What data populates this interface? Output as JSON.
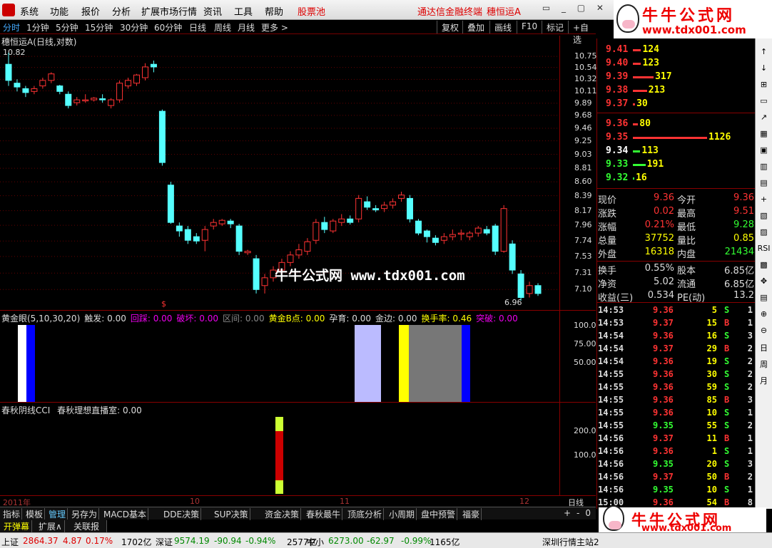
{
  "menu": [
    "系统",
    "功能",
    "报价",
    "分析",
    "扩展市场行情",
    "资讯",
    "工具",
    "帮助"
  ],
  "menu_red": "股票池",
  "app_title": "通达信金融终端",
  "stock_title": "穗恒运A",
  "banner": {
    "title": "牛牛公式网",
    "url": "www.tdx001.com"
  },
  "periods": [
    "分时",
    "1分钟",
    "5分钟",
    "15分钟",
    "30分钟",
    "60分钟",
    "日线",
    "周线",
    "月线",
    "更多 >"
  ],
  "tool_buttons": [
    "复权",
    "叠加",
    "画线",
    "F10",
    "标记",
    "+自选"
  ],
  "chart_title": "穗恒运A(日线,对数)",
  "high_label": "10.82",
  "low_label": "6.96",
  "watermark": "牛牛公式网 www.tdx001.com",
  "price_ticks": [
    "10.75",
    "10.54",
    "10.32",
    "10.11",
    "9.89",
    "9.68",
    "9.46",
    "9.25",
    "9.03",
    "8.81",
    "8.60",
    "8.39",
    "8.17",
    "7.96",
    "7.74",
    "7.53",
    "7.31",
    "7.10"
  ],
  "ind1": {
    "name": "黄金眼(5,10,30,20)",
    "items": [
      {
        "l": "触发: 0.00",
        "c": "#ddd"
      },
      {
        "l": "回踩: 0.00",
        "c": "#e0e"
      },
      {
        "l": "破坏: 0.00",
        "c": "#e0e"
      },
      {
        "l": "区间: 0.00",
        "c": "#888"
      },
      {
        "l": "黄金B点: 0.00",
        "c": "#ff0"
      },
      {
        "l": "孕育: 0.00",
        "c": "#ddd"
      },
      {
        "l": "金边: 0.00",
        "c": "#ddd"
      },
      {
        "l": "换手率: 0.46",
        "c": "#ff0"
      },
      {
        "l": "突破: 0.00",
        "c": "#e0e"
      }
    ],
    "ticks": [
      "100.0",
      "75.00",
      "50.00"
    ]
  },
  "ind2": {
    "name": "春秋阴线CCI",
    "sub": "春秋理想直播室: 0.00",
    "ticks": [
      "200.0",
      "100.0"
    ]
  },
  "dates": [
    "2011年",
    "10",
    "11",
    "12"
  ],
  "date_period": "日线",
  "tabs": [
    "指标",
    "模板",
    "管理",
    "另存为",
    "MACD基本",
    "DDE决策",
    "SUP决策",
    "资金决策",
    "春秋最牛",
    "顶底分析",
    "小周期",
    "盘中预警",
    "福豪"
  ],
  "tabs2": [
    "开弹幕",
    "扩展∧",
    "关联报价"
  ],
  "order_book": {
    "asks": [
      {
        "p": "9.41",
        "v": "124",
        "w": 0.11
      },
      {
        "p": "9.40",
        "v": "123",
        "w": 0.11
      },
      {
        "p": "9.39",
        "v": "317",
        "w": 0.28
      },
      {
        "p": "9.38",
        "v": "213",
        "w": 0.19
      },
      {
        "p": "9.37",
        "v": "30",
        "w": 0.03
      }
    ],
    "bids": [
      {
        "p": "9.36",
        "v": "80",
        "w": 0.07
      },
      {
        "p": "9.35",
        "v": "1126",
        "w": 1.0
      },
      {
        "p": "9.34",
        "v": "113",
        "w": 0.1
      },
      {
        "p": "9.33",
        "v": "191",
        "w": 0.17
      },
      {
        "p": "9.32",
        "v": "16",
        "w": 0.02
      }
    ]
  },
  "quote": [
    [
      "现价",
      "9.36",
      "今开",
      "9.36"
    ],
    [
      "涨跌",
      "0.02",
      "最高",
      "9.51"
    ],
    [
      "涨幅",
      "0.21%",
      "最低",
      "9.28"
    ],
    [
      "总量",
      "37752",
      "量比",
      "0.85"
    ],
    [
      "外盘",
      "16318",
      "内盘",
      "21434"
    ],
    [
      "换手",
      "0.55%",
      "股本",
      "6.85亿"
    ],
    [
      "净资",
      "5.02",
      "流通",
      "6.85亿"
    ],
    [
      "收益(三)",
      "0.534",
      "PE(动)",
      "13.2"
    ]
  ],
  "trades": [
    [
      "14:53",
      "9.36",
      "5",
      "S",
      "1"
    ],
    [
      "14:53",
      "9.37",
      "15",
      "B",
      "1"
    ],
    [
      "14:54",
      "9.36",
      "16",
      "S",
      "3"
    ],
    [
      "14:54",
      "9.37",
      "29",
      "B",
      "2"
    ],
    [
      "14:54",
      "9.36",
      "19",
      "S",
      "2"
    ],
    [
      "14:55",
      "9.36",
      "30",
      "S",
      "2"
    ],
    [
      "14:55",
      "9.36",
      "59",
      "S",
      "2"
    ],
    [
      "14:55",
      "9.36",
      "85",
      "B",
      "3"
    ],
    [
      "14:55",
      "9.36",
      "10",
      "S",
      "1"
    ],
    [
      "14:55",
      "9.35",
      "55",
      "S",
      "2"
    ],
    [
      "14:56",
      "9.37",
      "11",
      "B",
      "1"
    ],
    [
      "14:56",
      "9.36",
      "1",
      "S",
      "1"
    ],
    [
      "14:56",
      "9.35",
      "20",
      "S",
      "3"
    ],
    [
      "14:56",
      "9.37",
      "50",
      "B",
      "2"
    ],
    [
      "14:56",
      "9.35",
      "10",
      "S",
      "1"
    ],
    [
      "15:00",
      "9.36",
      "54",
      "B",
      "8"
    ]
  ],
  "status": [
    {
      "t": "上证",
      "c": "#000"
    },
    {
      "t": "2864.37",
      "c": "#d00"
    },
    {
      "t": "4.87",
      "c": "#d00"
    },
    {
      "t": "0.17%",
      "c": "#d00"
    },
    {
      "t": "1702亿",
      "c": "#000"
    },
    {
      "t": "深证",
      "c": "#000"
    },
    {
      "t": "9574.19",
      "c": "#080"
    },
    {
      "t": "-90.94",
      "c": "#080"
    },
    {
      "t": "-0.94%",
      "c": "#080"
    },
    {
      "t": "2577亿",
      "c": "#000"
    },
    {
      "t": "中小",
      "c": "#000"
    },
    {
      "t": "6273.00",
      "c": "#080"
    },
    {
      "t": "-62.97",
      "c": "#080"
    },
    {
      "t": "-0.99%",
      "c": "#080"
    },
    {
      "t": "1165亿",
      "c": "#000"
    },
    {
      "t": "深圳行情主站2",
      "c": "#000"
    }
  ],
  "vtools": [
    "↑",
    "↓",
    "⊞",
    "▭",
    "↗",
    "▦",
    "▣",
    "▥",
    "▤",
    "+",
    "▧",
    "▨",
    "RSI",
    "▩",
    "✥",
    "▤",
    "⊕",
    "⊖",
    "日",
    "周",
    "月"
  ],
  "candles": [
    [
      10.6,
      10.3,
      10.82,
      10.2
    ],
    [
      10.25,
      10.18,
      10.32,
      10.1
    ],
    [
      10.15,
      10.08,
      10.2,
      10.0
    ],
    [
      10.1,
      10.15,
      10.2,
      10.05
    ],
    [
      10.2,
      10.3,
      10.35,
      10.15
    ],
    [
      10.3,
      10.42,
      10.45,
      10.25
    ],
    [
      10.2,
      10.1,
      10.22,
      10.05
    ],
    [
      10.05,
      9.85,
      10.1,
      9.8
    ],
    [
      9.9,
      9.95,
      10.0,
      9.85
    ],
    [
      9.95,
      9.95,
      10.05,
      9.9
    ],
    [
      9.95,
      9.98,
      10.0,
      9.92
    ],
    [
      9.97,
      9.95,
      10.05,
      9.9
    ],
    [
      9.85,
      9.95,
      9.98,
      9.8
    ],
    [
      9.95,
      10.25,
      10.3,
      9.9
    ],
    [
      10.2,
      10.3,
      10.35,
      10.15
    ],
    [
      10.25,
      10.4,
      10.42,
      10.2
    ],
    [
      10.35,
      10.55,
      10.62,
      10.3
    ],
    [
      10.6,
      10.55,
      10.67,
      10.45
    ],
    [
      9.75,
      8.9,
      9.78,
      8.85
    ],
    [
      8.55,
      8.0,
      8.6,
      7.98
    ],
    [
      7.95,
      7.88,
      8.0,
      7.8
    ],
    [
      7.9,
      7.75,
      7.95,
      7.7
    ],
    [
      7.8,
      7.74,
      7.85,
      7.7
    ],
    [
      7.75,
      7.9,
      7.95,
      7.6
    ],
    [
      7.95,
      8.0,
      8.05,
      7.9
    ],
    [
      7.98,
      8.03,
      8.05,
      7.95
    ],
    [
      8.02,
      7.98,
      8.05,
      7.92
    ],
    [
      7.95,
      7.6,
      7.98,
      7.55
    ],
    [
      7.58,
      7.6,
      7.62,
      7.55
    ],
    [
      7.5,
      7.1,
      7.55,
      7.05
    ],
    [
      7.15,
      7.25,
      7.3,
      7.05
    ],
    [
      7.25,
      7.35,
      7.4,
      7.2
    ],
    [
      7.35,
      7.45,
      7.5,
      7.3
    ],
    [
      7.45,
      7.55,
      7.6,
      7.4
    ],
    [
      7.55,
      7.62,
      7.7,
      7.5
    ],
    [
      7.6,
      7.73,
      7.78,
      7.55
    ],
    [
      7.75,
      8.0,
      8.05,
      7.7
    ],
    [
      8.0,
      7.9,
      8.08,
      7.85
    ],
    [
      7.88,
      8.02,
      8.05,
      7.85
    ],
    [
      8.0,
      8.05,
      8.12,
      7.95
    ],
    [
      8.05,
      8.0,
      8.1,
      7.97
    ],
    [
      8.05,
      8.35,
      8.4,
      8.0
    ],
    [
      8.3,
      8.22,
      8.38,
      8.18
    ],
    [
      8.2,
      8.18,
      8.25,
      8.15
    ],
    [
      8.2,
      8.25,
      8.3,
      8.15
    ],
    [
      8.25,
      8.3,
      8.35,
      8.2
    ],
    [
      8.35,
      8.4,
      8.45,
      8.3
    ],
    [
      8.35,
      8.05,
      8.4,
      8.0
    ],
    [
      8.02,
      7.85,
      8.05,
      7.82
    ],
    [
      7.88,
      7.8,
      7.9,
      7.72
    ],
    [
      7.78,
      7.72,
      7.82,
      7.68
    ],
    [
      7.75,
      7.8,
      7.85,
      7.7
    ],
    [
      7.8,
      7.83,
      7.9,
      7.75
    ],
    [
      7.85,
      7.85,
      7.9,
      7.75
    ],
    [
      7.8,
      7.85,
      7.88,
      7.75
    ],
    [
      7.85,
      7.92,
      7.95,
      7.8
    ],
    [
      7.9,
      7.85,
      7.95,
      7.82
    ],
    [
      7.95,
      7.6,
      7.98,
      7.55
    ],
    [
      7.6,
      8.2,
      8.25,
      7.58
    ],
    [
      7.7,
      7.35,
      7.75,
      7.3
    ],
    [
      7.3,
      7.0,
      7.35,
      6.96
    ],
    [
      7.05,
      7.15,
      7.2,
      7.0
    ],
    [
      7.15,
      7.05,
      7.18,
      7.02
    ]
  ]
}
